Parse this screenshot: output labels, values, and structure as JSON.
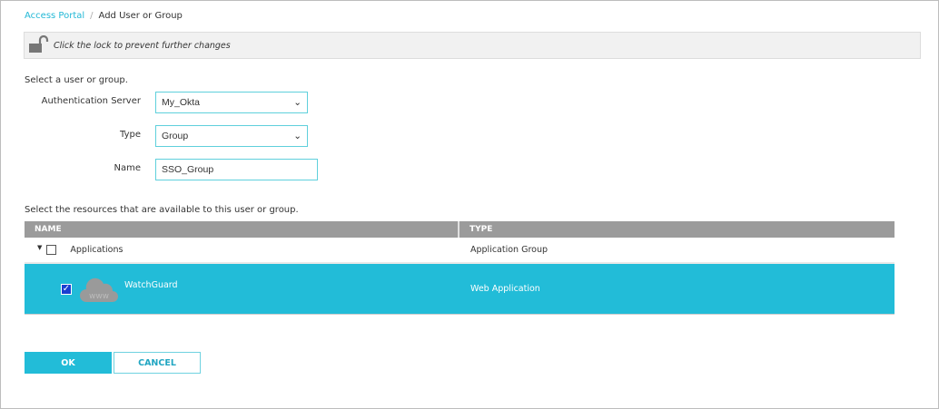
{
  "breadcrumb": {
    "parent": "Access Portal",
    "separator": "/",
    "current": "Add User or Group"
  },
  "lock": {
    "message": "Click the lock to prevent further changes"
  },
  "form": {
    "intro": "Select a user or group.",
    "auth_server_label": "Authentication Server",
    "auth_server_value": "My_Okta",
    "type_label": "Type",
    "type_value": "Group",
    "name_label": "Name",
    "name_value": "SSO_Group"
  },
  "resources": {
    "intro": "Select the resources that are available to this user or group.",
    "columns": [
      "NAME",
      "TYPE"
    ],
    "rows": [
      {
        "name": "Applications",
        "type": "Application Group",
        "checked": false
      },
      {
        "name": "WatchGuard",
        "type": "Web Application",
        "checked": true,
        "icon_text": "www"
      }
    ]
  },
  "buttons": {
    "ok": "OK",
    "cancel": "CANCEL"
  },
  "colors": {
    "accent": "#22bcd8",
    "header": "#9b9b9b"
  }
}
